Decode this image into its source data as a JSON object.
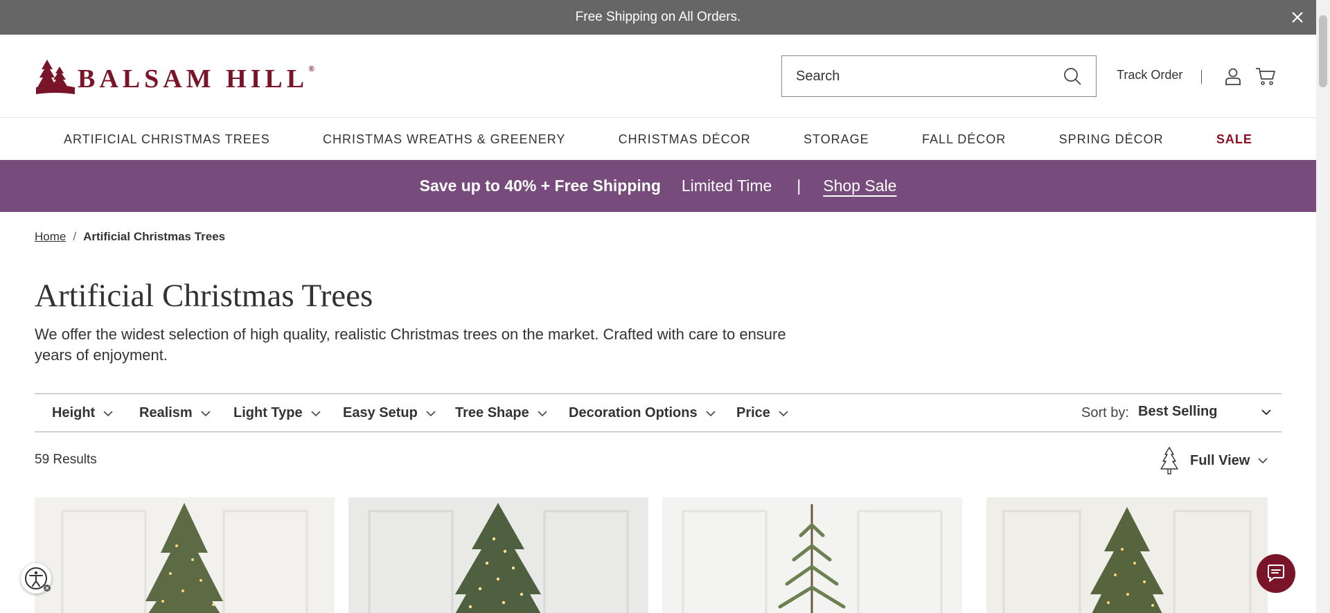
{
  "announcement": {
    "text": "Free Shipping on All Orders."
  },
  "header": {
    "brand": "BALSAM HILL",
    "brand_mark": "®",
    "search_placeholder": "Search",
    "track_order": "Track Order"
  },
  "nav": {
    "items": [
      "ARTIFICIAL CHRISTMAS TREES",
      "CHRISTMAS WREATHS & GREENERY",
      "CHRISTMAS DÉCOR",
      "STORAGE",
      "FALL DÉCOR",
      "SPRING DÉCOR",
      "SALE"
    ]
  },
  "promo": {
    "headline": "Save up to 40% + Free Shipping",
    "sub": "Limited Time",
    "separator": "|",
    "link": "Shop Sale",
    "color": "#774c7d"
  },
  "breadcrumb": {
    "home": "Home",
    "separator": "/",
    "current": "Artificial Christmas Trees"
  },
  "page": {
    "title": "Artificial Christmas Trees",
    "description": "We offer the widest selection of high quality, realistic Christmas trees on the market. Crafted with care to ensure years of enjoyment."
  },
  "filters": {
    "items": [
      "Height",
      "Realism",
      "Light Type",
      "Easy Setup",
      "Tree Shape",
      "Decoration Options",
      "Price"
    ],
    "sort_label": "Sort by:",
    "sort_value": "Best Selling"
  },
  "results": {
    "count_text": "59 Results",
    "view_label": "Full View"
  },
  "products": [
    {
      "icon": "lit-spruce-tree-image"
    },
    {
      "icon": "lit-fir-tree-image"
    },
    {
      "icon": "sparse-pine-tree-image"
    },
    {
      "icon": "lit-spruce-tree-image"
    }
  ],
  "colors": {
    "announcement_bg": "#666666",
    "brand": "#7a1428",
    "sale": "#8b1020"
  }
}
